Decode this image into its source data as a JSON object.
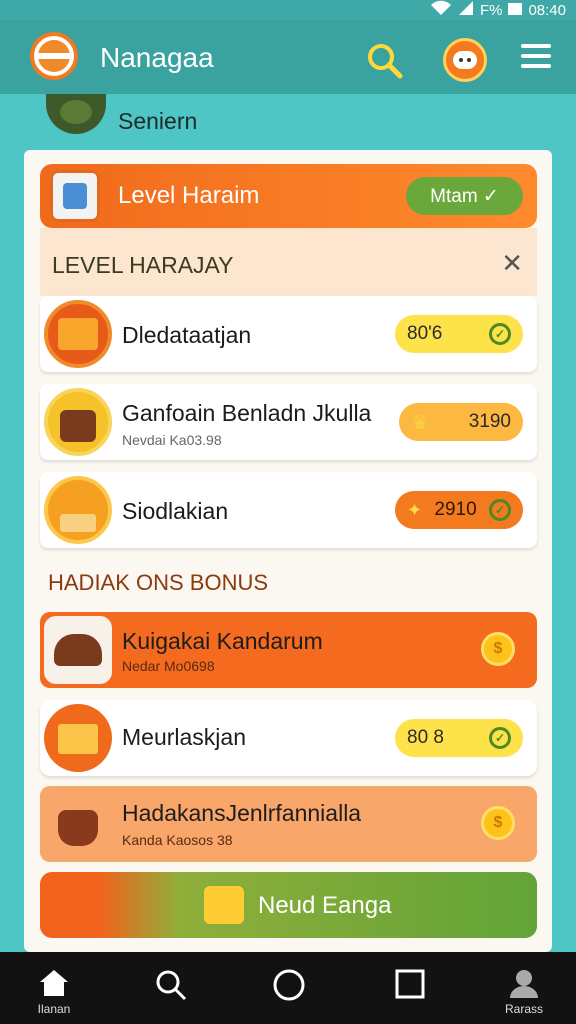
{
  "status_bar": {
    "battery": "F%",
    "time": "08:40"
  },
  "app_bar": {
    "title": "Nanagaa"
  },
  "section": {
    "title": "Seniern"
  },
  "level_banner": {
    "title": "Level Haraim",
    "action_label": "Mtam ✓"
  },
  "level_list": {
    "header": "LEVEL HARAJAY",
    "close_glyph": "✕",
    "items": [
      {
        "name": "Dledataatjan",
        "subtitle": "",
        "badge": "80'6"
      },
      {
        "name": "Ganfoain Benladn Jkulla",
        "subtitle": "Nevdai Ka03.98",
        "badge": "3190"
      },
      {
        "name": "Siodlakian",
        "subtitle": "",
        "badge": "2910"
      }
    ]
  },
  "bonus": {
    "header": "HADIAK ONS BONUS",
    "items": [
      {
        "name": "Kuigakai Kandarum",
        "subtitle": "Nedar Mo0698",
        "badge": ""
      },
      {
        "name": "Meurlaskjan",
        "subtitle": "",
        "badge": "80 8"
      },
      {
        "name": "HadakansJenlrfannialla",
        "subtitle": "Kanda Kaosos 38",
        "badge": ""
      }
    ]
  },
  "cta": {
    "label": "Neud Eanga"
  },
  "navbar": {
    "items": [
      {
        "label": "Ilanan",
        "icon": "home-icon"
      },
      {
        "label": "",
        "icon": "search-icon"
      },
      {
        "label": "",
        "icon": "circle-icon"
      },
      {
        "label": "",
        "icon": "square-icon"
      },
      {
        "label": "Rarass",
        "icon": "profile-icon"
      }
    ]
  },
  "colors": {
    "teal": "#3aa39f",
    "orange": "#f06a1c",
    "green": "#6aa83c",
    "yellow": "#ffd93a"
  }
}
